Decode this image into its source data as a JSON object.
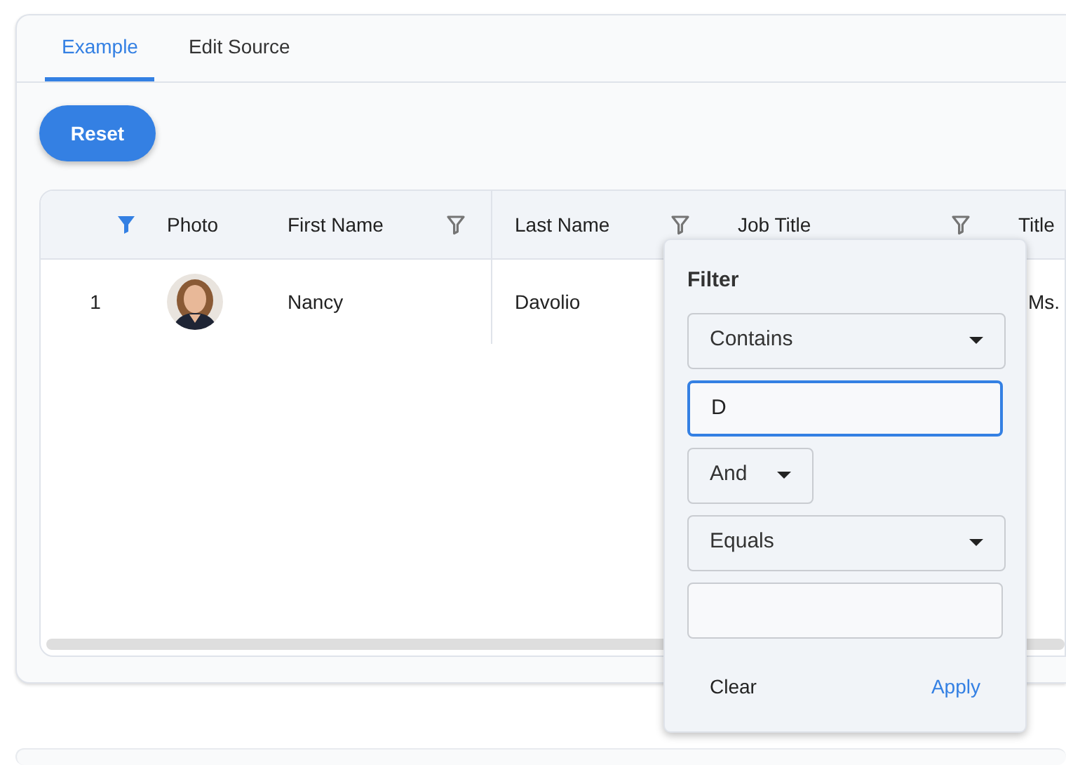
{
  "tabs": [
    {
      "label": "Example",
      "selected": true
    },
    {
      "label": "Edit Source",
      "selected": false
    }
  ],
  "reset_button": "Reset",
  "table": {
    "columns": [
      {
        "filtered": true
      },
      {
        "label": "Photo"
      },
      {
        "label": "First Name",
        "filtered": false
      },
      {
        "label": "Last Name",
        "filtered": false
      },
      {
        "label": "Job Title",
        "filtered": false
      },
      {
        "label": "Title"
      }
    ],
    "rows": [
      {
        "cells": [
          {
            "kind": "text",
            "text": "1"
          },
          {
            "kind": "picture"
          },
          {
            "kind": "text",
            "text": "Nancy"
          },
          {
            "kind": "text",
            "text": "Davolio"
          },
          {
            "kind": "empty"
          },
          {
            "kind": "text",
            "text": "Ms."
          }
        ]
      }
    ]
  },
  "filter_popup": {
    "title": "Filter",
    "operator_1": "Contains",
    "value_1": "D",
    "join": "And",
    "operator_2": "Equals",
    "buttons": [
      {
        "label": "Clear",
        "kind": "secondary"
      },
      {
        "label": "Apply",
        "kind": "primary"
      }
    ]
  }
}
